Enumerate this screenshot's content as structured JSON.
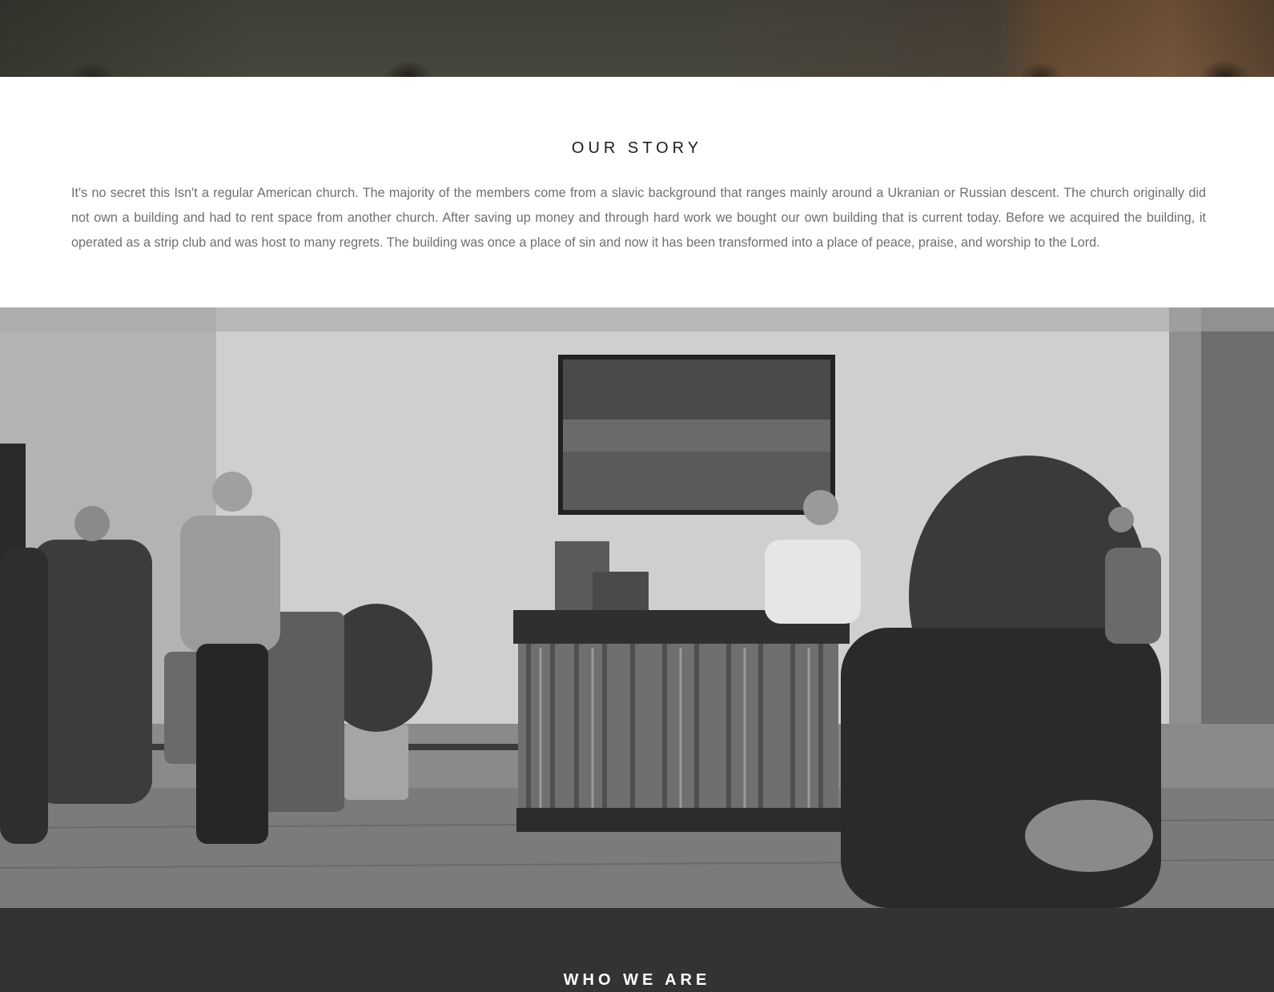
{
  "story": {
    "title": "OUR STORY",
    "text": "It's no secret this Isn't a regular American church. The majority of the members come from a slavic background that ranges mainly around a Ukranian or Russian descent. The church originally did not own a building and had to rent space from another church. After saving up money and through hard work we bought our own building that is current today. Before we acquired the building, it operated as a strip club and was host to many regrets. The building was once a place of sin and now it has been transformed into a place of peace, praise, and worship to the Lord."
  },
  "who": {
    "title": "WHO WE ARE"
  },
  "colors": {
    "dark_section": "#333333",
    "body_text": "#6f6f6f",
    "heading_text": "#1c1c1c"
  }
}
